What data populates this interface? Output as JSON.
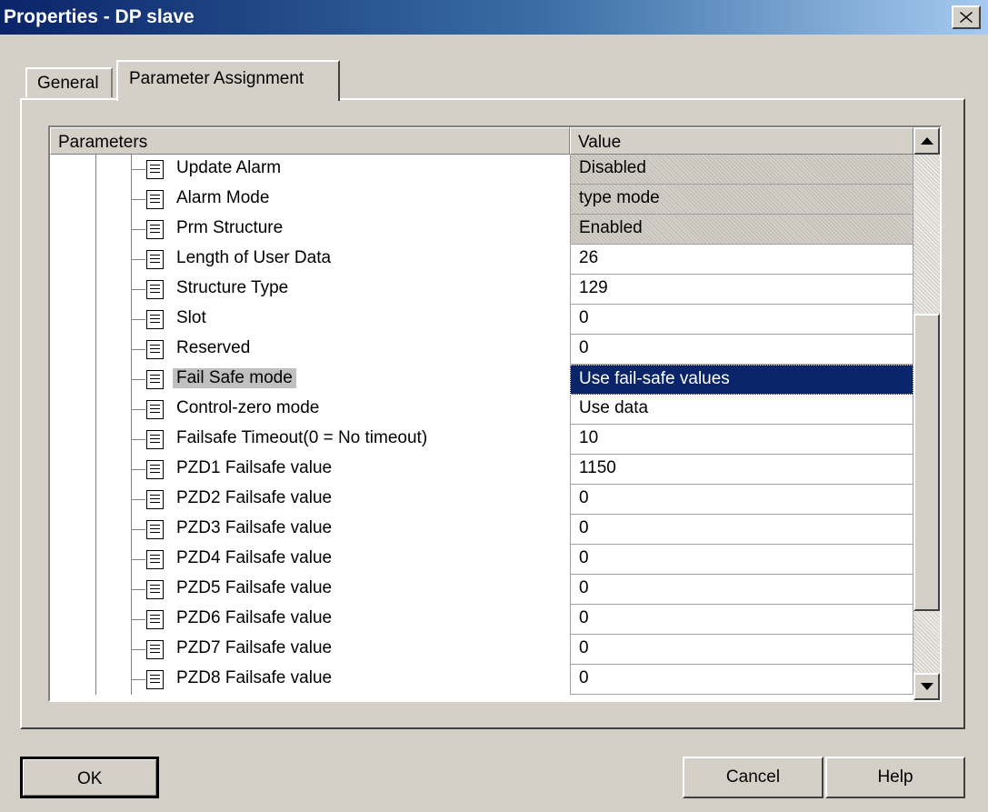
{
  "window": {
    "title": "Properties - DP slave"
  },
  "tabs": [
    {
      "label": "General",
      "active": false
    },
    {
      "label": "Parameter Assignment",
      "active": true
    }
  ],
  "grid": {
    "columns": [
      "Parameters",
      "Value"
    ],
    "rows": [
      {
        "name": "Update Alarm",
        "value": "Disabled",
        "readonly": true
      },
      {
        "name": "Alarm Mode",
        "value": "type mode",
        "readonly": true
      },
      {
        "name": "Prm Structure",
        "value": "Enabled",
        "readonly": true
      },
      {
        "name": "Length of User Data",
        "value": "26"
      },
      {
        "name": "Structure Type",
        "value": "129"
      },
      {
        "name": "Slot",
        "value": "0"
      },
      {
        "name": "Reserved",
        "value": "0"
      },
      {
        "name": "Fail Safe mode",
        "value": "Use fail-safe values",
        "selected": true
      },
      {
        "name": "Control-zero mode",
        "value": "Use data"
      },
      {
        "name": "Failsafe Timeout(0 = No timeout)",
        "value": "10"
      },
      {
        "name": "PZD1 Failsafe value",
        "value": "1150"
      },
      {
        "name": "PZD2 Failsafe value",
        "value": "0"
      },
      {
        "name": "PZD3 Failsafe value",
        "value": "0"
      },
      {
        "name": "PZD4 Failsafe value",
        "value": "0"
      },
      {
        "name": "PZD5 Failsafe value",
        "value": "0"
      },
      {
        "name": "PZD6 Failsafe value",
        "value": "0"
      },
      {
        "name": "PZD7 Failsafe value",
        "value": "0"
      },
      {
        "name": "PZD8 Failsafe value",
        "value": "0"
      }
    ]
  },
  "buttons": {
    "ok": "OK",
    "cancel": "Cancel",
    "help": "Help"
  },
  "icons": {
    "close": "close-icon",
    "param": "parameter-document-icon",
    "scroll_up": "scroll-up-arrow-icon",
    "scroll_down": "scroll-down-arrow-icon"
  },
  "colors": {
    "selection": "#0a246a",
    "face": "#d4d0c8",
    "title_start": "#0a246a",
    "title_end": "#a6caf0"
  }
}
